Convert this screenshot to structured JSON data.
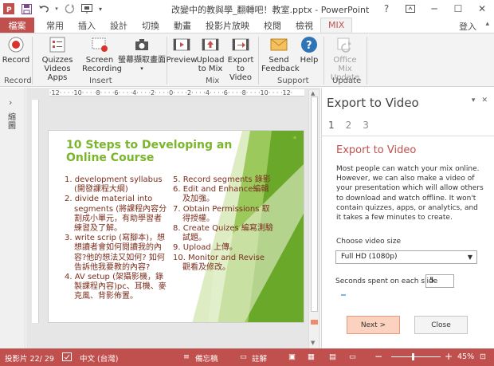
{
  "window": {
    "title": "改變中的教與學_翻轉吧！教室.pptx - PowerPoint",
    "help": "?",
    "minimize": "─",
    "restore": "☐",
    "close": "✕"
  },
  "tabs": [
    {
      "label": "檔案"
    },
    {
      "label": "常用"
    },
    {
      "label": "插入"
    },
    {
      "label": "設計"
    },
    {
      "label": "切換"
    },
    {
      "label": "動畫"
    },
    {
      "label": "投影片放映"
    },
    {
      "label": "校閱"
    },
    {
      "label": "檢視"
    },
    {
      "label": "MIX"
    }
  ],
  "account": {
    "signin": "登入"
  },
  "ribbon": {
    "record": {
      "label": "Record",
      "group": "Record"
    },
    "insert_group": "Insert",
    "quizzes": "Quizzes Videos Apps",
    "screen_recording": "Screen Recording",
    "screenshot": "螢幕擷取畫面",
    "preview": "Preview",
    "upload": "Upload to Mix",
    "export": "Export to Video",
    "mix_group": "Mix",
    "feedback": "Send Feedback",
    "help": "Help",
    "support_group": "Support",
    "update": "Office Mix Update",
    "update_group": "Update"
  },
  "thumbnails": {
    "label": "縮圖"
  },
  "ruler": {
    "marks": "·12· · · ·10· · · ·8· · · ·6· · · ·4· · · ·2· · · ·0· · · ·2· · · ·4· · · ·6· · · ·8· · · ·10· · · ·12·"
  },
  "slide": {
    "title": "10 Steps to Developing an Online Course",
    "left_items": [
      "1. development syllabus (開發課程大綱)",
      "2. divide material into segments (將課程內容分割成小單元，有助學習者練習及了解。",
      "3. write scrip (寫腳本)，想想讀者會如何閱讀我的內容?他的想法又如何? 如何告訴他我要教的內容?",
      "4. AV setup (架攝影機，錄製課程內容)pc、耳機、麥克風、背影佈置。"
    ],
    "right_items": [
      "5. Record segments 錄影",
      "6. Edit and Enhance編輯及加強。",
      "7. Obtain Permissions 取得授權。",
      "8. Create Quizes 編寫測驗試題。",
      "9. Upload 上傳。",
      "10. Monitor and  Revise 觀看及修改。"
    ]
  },
  "export_pane": {
    "header": "Export to Video",
    "steps": [
      "1",
      "2",
      "3"
    ],
    "section_title": "Export to Video",
    "description": "Most people can watch your mix online. However, we can also make a video of your presentation which will allow others to download and watch offline. It won't contain quizzes, apps, or analytics, and it takes a few minutes to create.",
    "size_label": "Choose video size",
    "size_value": "Full HD (1080p)",
    "seconds_label": "Seconds spent on each slide",
    "seconds_value": "5",
    "next_label": "Next >",
    "close_label": "Close"
  },
  "status": {
    "slide_info": "投影片 22/ 29",
    "language": "中文 (台灣)",
    "notes": "備忘稿",
    "comments": "註解",
    "zoom": "45%",
    "zoom_level": 0.45
  },
  "colors": {
    "accent": "#c0504d",
    "title_green": "#7ab52c",
    "body_text": "#7a2e1d"
  }
}
